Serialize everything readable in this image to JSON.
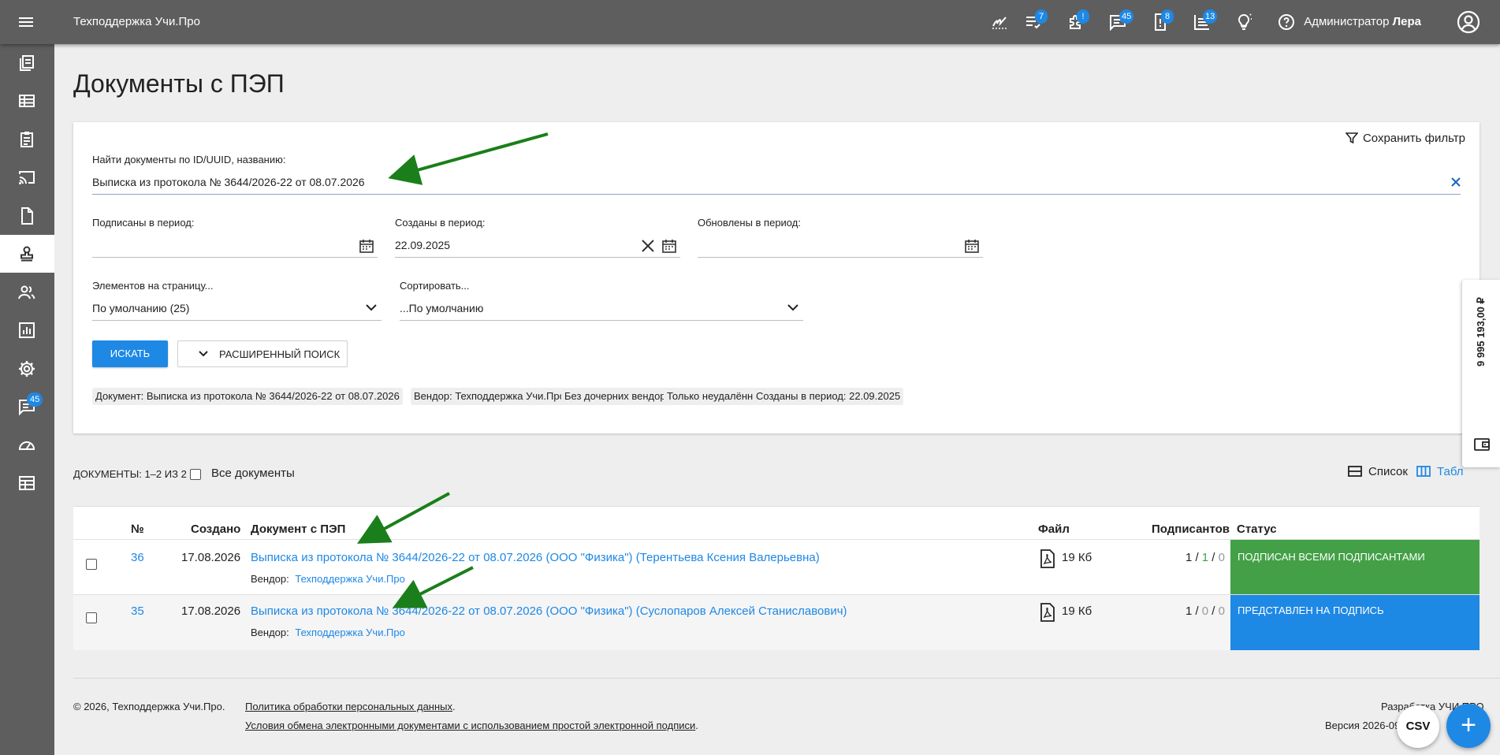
{
  "header": {
    "title": "Техподдержка Учи.Про",
    "user_role": "Администратор",
    "user_name": "Лера",
    "badges": {
      "tasks": "7",
      "plugins": "!",
      "messages": "45",
      "alerts": "8",
      "list": "13"
    }
  },
  "sidebar": {
    "items": [
      {
        "icon": "documents-icon"
      },
      {
        "icon": "table-icon"
      },
      {
        "icon": "clipboard-icon"
      },
      {
        "icon": "cast-icon"
      },
      {
        "icon": "file-icon"
      },
      {
        "icon": "stamp-icon"
      },
      {
        "icon": "users-icon"
      },
      {
        "icon": "chart-icon"
      },
      {
        "icon": "gear-icon"
      },
      {
        "icon": "chat-icon",
        "badge": "45"
      },
      {
        "icon": "speedometer-icon"
      },
      {
        "icon": "calendar-table-icon"
      }
    ]
  },
  "page": {
    "title": "Документы с ПЭП"
  },
  "filter": {
    "save_filter": "Сохранить фильтр",
    "search_label": "Найти документы по ID/UUID, названию:",
    "search_value": "Выписка из протокола № 3644/2026-22 от 08.07.2026",
    "signed_label": "Подписаны в период:",
    "signed_value": "",
    "created_label": "Созданы в период:",
    "created_value": "22.09.2025",
    "updated_label": "Обновлены в период:",
    "updated_value": "",
    "per_page_label": "Элементов на страницу...",
    "per_page_value": "По умолчанию (25)",
    "sort_label": "Сортировать...",
    "sort_value": "...По умолчанию",
    "search_button": "ИСКАТЬ",
    "advanced_button": "РАСШИРЕННЫЙ ПОИСК",
    "chips": [
      "Документ: Выписка из протокола № 3644/2026-22 от 08.07.2026",
      "Вендор: Техподдержка Учи.Про",
      "Без дочерних вендоров",
      "Только неудалённые",
      "Созданы в период: 22.09.2025"
    ]
  },
  "list": {
    "count": "ДОКУМЕНТЫ: 1–2 ИЗ 2",
    "all_docs": "Все документы",
    "view_list": "Список",
    "view_table": "Табл"
  },
  "table": {
    "headers": {
      "num": "№",
      "created": "Создано",
      "doc": "Документ с ПЭП",
      "file": "Файл",
      "signers": "Подписантов",
      "status": "Статус"
    },
    "vendor_label": "Вендор:",
    "rows": [
      {
        "num": "36",
        "created": "17.08.2026",
        "doc": "Выписка из протокола № 3644/2026-22 от 08.07.2026 (ООО \"Физика\") (Терентьева Ксения Валерьевна)",
        "vendor": "Техподдержка Учи.Про",
        "file_size": "19 Кб",
        "signed": "1",
        "sep1": " / ",
        "middle": "1",
        "sep2": " / ",
        "last": "0",
        "status": "ПОДПИСАН ВСЕМИ ПОДПИСАНТАМИ",
        "status_color": "#43a047"
      },
      {
        "num": "35",
        "created": "17.08.2026",
        "doc": "Выписка из протокола № 3644/2026-22 от 08.07.2026 (ООО \"Физика\") (Суслопаров Алексей Станиславович)",
        "vendor": "Техподдержка Учи.Про",
        "file_size": "19 Кб",
        "signed": "1",
        "sep1": " / ",
        "middle": "0",
        "sep2": " / ",
        "last": "0",
        "status": "ПРЕДСТАВЛЕН НА ПОДПИСЬ",
        "status_color": "#1e88e5"
      }
    ]
  },
  "footer": {
    "copyright": "©  2026, Техподдержка Учи.Про.",
    "privacy": "Политика обработки персональных данных",
    "terms": "Условия обмена электронными документами с использованием простой электронной подписи",
    "developed": "Разработка УЧИ.ПРО",
    "version": "Версия 2026-09"
  },
  "side_panel": {
    "amount": "9 995 193,00 ₽"
  },
  "fab": {
    "csv": "CSV",
    "add": "+"
  },
  "colors": {
    "accent": "#1e88e5",
    "success": "#43a047",
    "header": "#5e5e5e",
    "arrow": "#1a7f1a"
  }
}
